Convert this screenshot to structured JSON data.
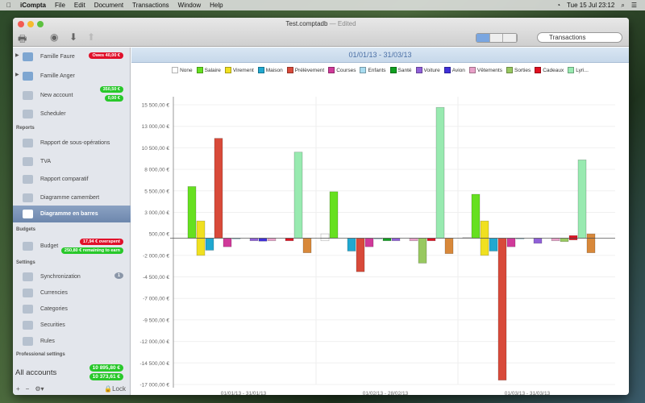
{
  "menubar": {
    "app": "iCompta",
    "items": [
      "File",
      "Edit",
      "Document",
      "Transactions",
      "Window",
      "Help"
    ],
    "clock": "Tue 15 Jul  23:12"
  },
  "window": {
    "title": "Test.comptadb",
    "edited": "— Edited",
    "search_placeholder": "Transactions"
  },
  "sidebar": {
    "accounts": [
      {
        "label": "Famille Faure",
        "badges": [
          "Owes 40,00 €"
        ]
      },
      {
        "label": "Famille Anger",
        "badges": []
      },
      {
        "label": "New account",
        "badges": [
          "350,50 €",
          "0,00 €"
        ]
      },
      {
        "label": "Scheduler",
        "badges": []
      }
    ],
    "reports_header": "Reports",
    "reports": [
      "Rapport de sous-opérations",
      "TVA",
      "Rapport comparatif",
      "Diagramme camembert",
      "Diagramme en barres"
    ],
    "budgets_header": "Budgets",
    "budget": {
      "label": "Budget",
      "overspent": "17,94 € overspent",
      "remaining": "250,80 € remaining to earn"
    },
    "settings_header": "Settings",
    "settings": [
      "Synchronization",
      "Currencies",
      "Categories",
      "Securities",
      "Rules"
    ],
    "sync_badge": "1",
    "pro_header": "Professional settings",
    "all_accounts": {
      "label": "All accounts",
      "balance1": "10 895,80 €",
      "balance2": "10 373,61 €"
    },
    "bottom": {
      "add": "+",
      "remove": "−",
      "gear": "⚙▾",
      "lock": "Lock"
    }
  },
  "main": {
    "period": "01/01/13 - 31/03/13"
  },
  "chart_data": {
    "type": "bar",
    "title": "01/01/13 - 31/03/13",
    "categories": [
      "01/01/13 - 31/01/13",
      "01/02/13 - 28/02/13",
      "01/03/13 - 31/03/13"
    ],
    "yticks": [
      "15 500,00 €",
      "13 000,00 €",
      "10 500,00 €",
      "8 000,00 €",
      "5 500,00 €",
      "3 000,00 €",
      "500,00 €",
      "-2 000,00 €",
      "-4 500,00 €",
      "-7 000,00 €",
      "-9 500,00 €",
      "-12 000,00 €",
      "-14 500,00 €",
      "-17 000,00 €"
    ],
    "ylim": [
      -17000,
      15500
    ],
    "legend": "top",
    "series": [
      {
        "name": "None",
        "color": "#ffffff",
        "values": [
          0,
          500,
          100
        ],
        "negative_values": [
          0,
          -300,
          0
        ]
      },
      {
        "name": "Salaire",
        "color": "#66e020",
        "values": [
          6000,
          5400,
          5100
        ],
        "negative_values": [
          0,
          0,
          0
        ]
      },
      {
        "name": "Virement",
        "color": "#f0e020",
        "values": [
          2000,
          0,
          2000
        ],
        "negative_values": [
          -2000,
          0,
          -2000
        ]
      },
      {
        "name": "Maison",
        "color": "#20a8d0",
        "values": [
          0,
          0,
          0
        ],
        "negative_values": [
          -1400,
          -1500,
          -1500
        ]
      },
      {
        "name": "Prélèvement",
        "color": "#d84a3a",
        "values": [
          11600,
          0,
          0
        ],
        "negative_values": [
          0,
          -3900,
          -16500
        ]
      },
      {
        "name": "Courses",
        "color": "#d03a9a",
        "values": [
          0,
          0,
          0
        ],
        "negative_values": [
          -1000,
          -1000,
          -1000
        ]
      },
      {
        "name": "Enfants",
        "color": "#a8dcf0",
        "values": [
          0,
          0,
          0
        ],
        "negative_values": [
          -100,
          -100,
          -100
        ]
      },
      {
        "name": "Santé",
        "color": "#10a020",
        "values": [
          0,
          0,
          0
        ],
        "negative_values": [
          0,
          -300,
          0
        ]
      },
      {
        "name": "Voiture",
        "color": "#9060d8",
        "values": [
          0,
          0,
          0
        ],
        "negative_values": [
          -300,
          -300,
          -600
        ]
      },
      {
        "name": "Avion",
        "color": "#4030d8",
        "values": [
          0,
          0,
          0
        ],
        "negative_values": [
          -350,
          0,
          0
        ]
      },
      {
        "name": "Vêtements",
        "color": "#e8a0c8",
        "values": [
          0,
          0,
          0
        ],
        "negative_values": [
          -300,
          -300,
          -300
        ]
      },
      {
        "name": "Sorties",
        "color": "#98c860",
        "values": [
          0,
          0,
          0
        ],
        "negative_values": [
          0,
          -2900,
          -400
        ]
      },
      {
        "name": "Cadeaux",
        "color": "#e01020",
        "values": [
          0,
          0,
          300
        ],
        "negative_values": [
          -300,
          -300,
          -200
        ]
      },
      {
        "name": "Lyri...",
        "color": "#98eab0",
        "values": [
          10000,
          15200,
          9100
        ],
        "negative_values": [
          0,
          0,
          0
        ]
      },
      {
        "name": "",
        "color": "#d8883a",
        "values": [
          0,
          0,
          500
        ],
        "negative_values": [
          -1700,
          -1800,
          -1700
        ]
      }
    ]
  }
}
